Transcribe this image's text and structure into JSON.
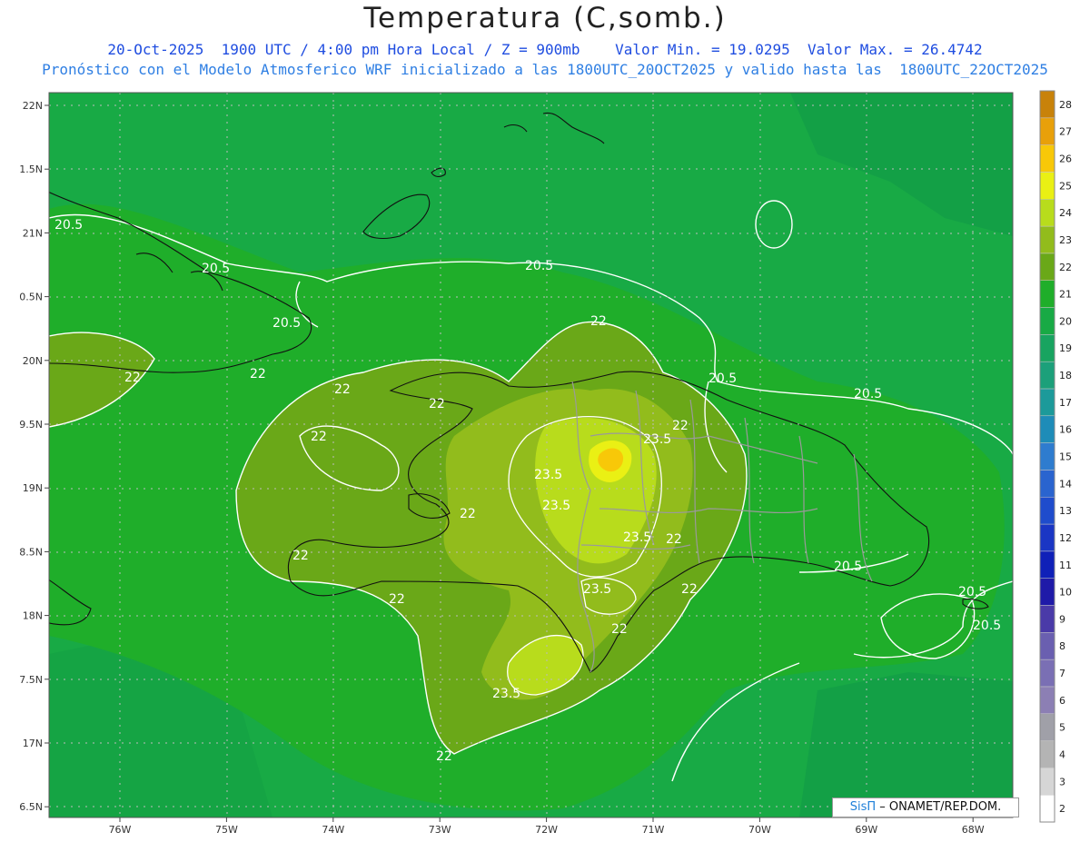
{
  "header": {
    "title": "Temperatura (C,somb.)",
    "line1": "20-Oct-2025  1900 UTC / 4:00 pm Hora Local / Z = 900mb    Valor Min. = 19.0295  Valor Max. = 26.4742",
    "line2": "Pronóstico con el Modelo Atmosferico WRF inicializado a las 1800UTC_20OCT2025 y valido hasta las  1800UTC_22OCT2025"
  },
  "lat_labels": [
    "22N",
    "1.5N",
    "21N",
    "0.5N",
    "20N",
    "9.5N",
    "19N",
    "8.5N",
    "18N",
    "7.5N",
    "17N",
    "6.5N"
  ],
  "lon_labels": [
    "76W",
    "75W",
    "74W",
    "73W",
    "72W",
    "71W",
    "70W",
    "69W",
    "68W"
  ],
  "colorbar": {
    "labels": [
      "2",
      "3",
      "4",
      "5",
      "6",
      "7",
      "8",
      "9",
      "10",
      "11",
      "12",
      "13",
      "14",
      "15",
      "16",
      "17",
      "18",
      "19",
      "20",
      "21",
      "22",
      "23",
      "24",
      "25",
      "26",
      "27",
      "28"
    ],
    "colors": [
      "#ffffff",
      "#d6d6d6",
      "#b4b4b4",
      "#a0a0a8",
      "#8c7fb4",
      "#7a6fb4",
      "#6a5fb0",
      "#4a3aa8",
      "#1f1aa8",
      "#0f20b8",
      "#1a36c4",
      "#1f4ccc",
      "#2a64cf",
      "#2e7ccf",
      "#1e8cb8",
      "#1c9a9a",
      "#1ca07a",
      "#18a460",
      "#18aa45",
      "#1fae2a",
      "#6aa818",
      "#92bc1c",
      "#b8dc1c",
      "#eaf014",
      "#f8c808",
      "#e8a00a",
      "#c8820a"
    ]
  },
  "contour_labels": [
    {
      "text": "20.5"
    },
    {
      "text": "20.5"
    },
    {
      "text": "20.5"
    },
    {
      "text": "20.5"
    },
    {
      "text": "20.5"
    },
    {
      "text": "20.5"
    },
    {
      "text": "20.5"
    },
    {
      "text": "20.5"
    },
    {
      "text": "20.5"
    },
    {
      "text": "22"
    },
    {
      "text": "22"
    },
    {
      "text": "22"
    },
    {
      "text": "22"
    },
    {
      "text": "22"
    },
    {
      "text": "22"
    },
    {
      "text": "22"
    },
    {
      "text": "22"
    },
    {
      "text": "22"
    },
    {
      "text": "22"
    },
    {
      "text": "22"
    },
    {
      "text": "22"
    },
    {
      "text": "22"
    },
    {
      "text": "23.5"
    },
    {
      "text": "23.5"
    },
    {
      "text": "23.5"
    },
    {
      "text": "23.5"
    },
    {
      "text": "23.5"
    },
    {
      "text": "23.5"
    }
  ],
  "credit": {
    "brand": "SisΠ",
    "text": "– ONAMET/REP.DOM."
  }
}
